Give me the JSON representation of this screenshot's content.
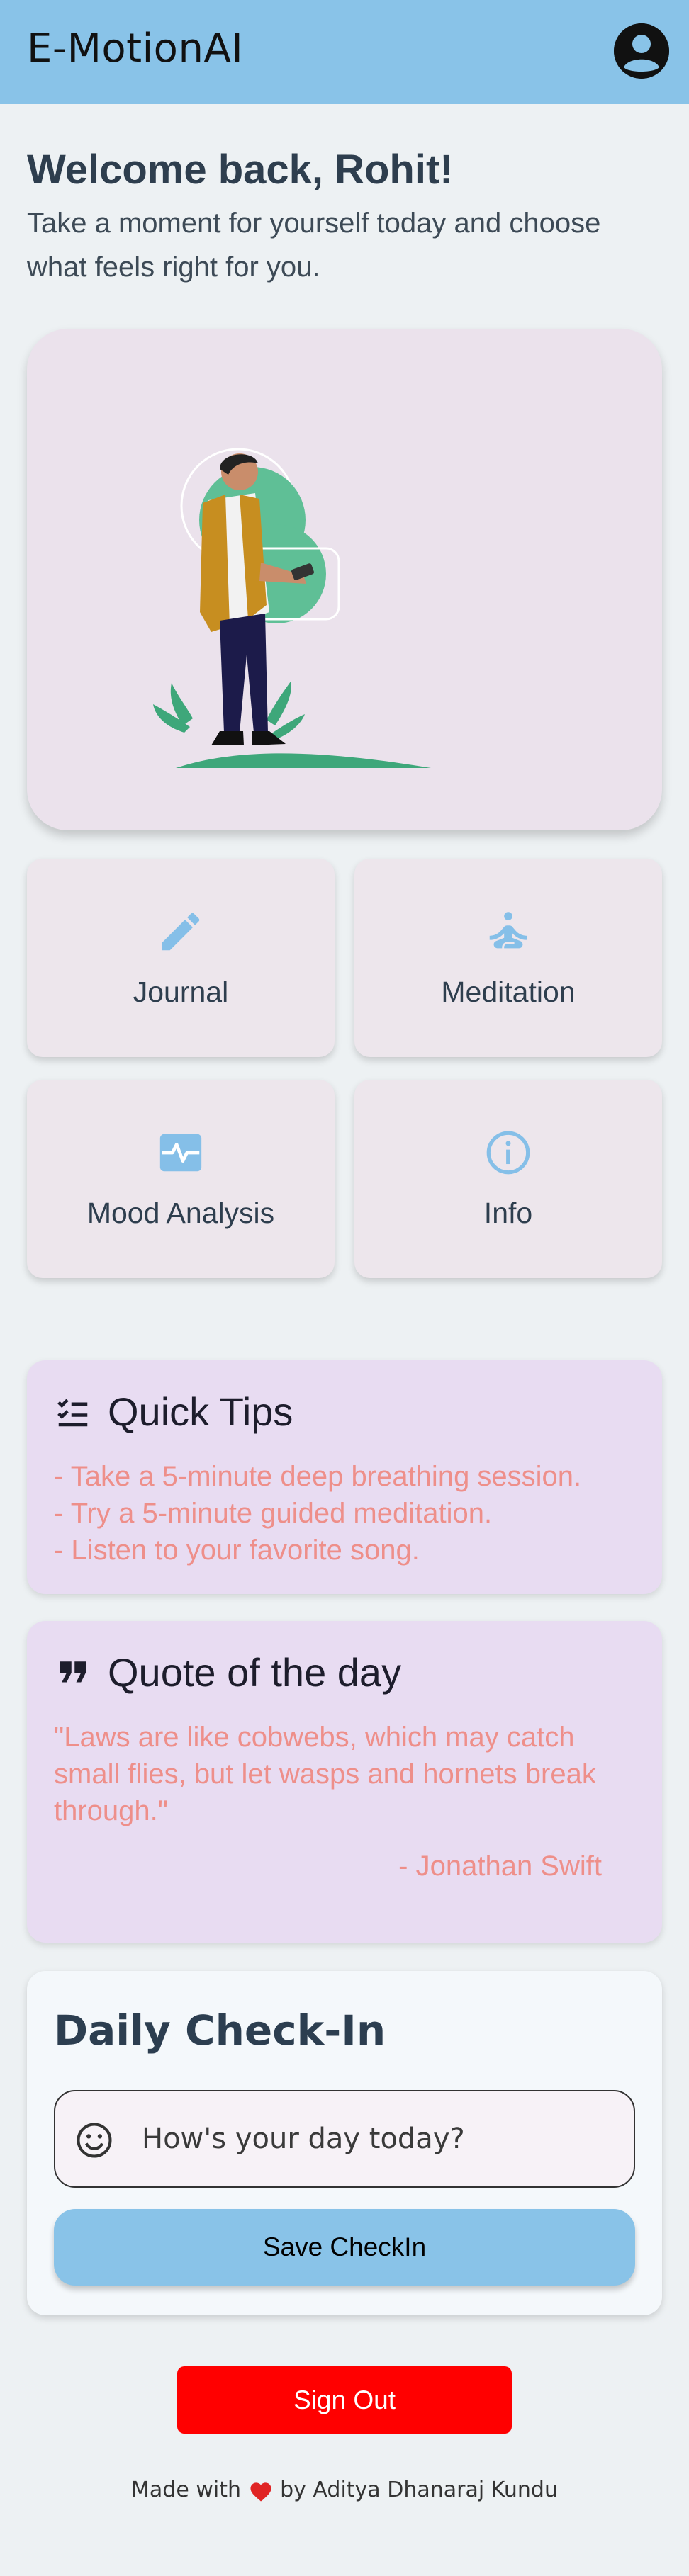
{
  "app": {
    "title": "E-MotionAI"
  },
  "header": {
    "avatar_icon": "account-circle-icon"
  },
  "welcome": {
    "title": "Welcome back, Rohit!",
    "subtitle": "Take a moment for yourself today and choose what feels right for you."
  },
  "hero": {
    "illustration": "person-with-phone-illustration"
  },
  "tiles": [
    {
      "label": "Journal",
      "icon": "pencil-icon"
    },
    {
      "label": "Meditation",
      "icon": "meditation-icon"
    },
    {
      "label": "Mood Analysis",
      "icon": "mood-pulse-icon"
    },
    {
      "label": "Info",
      "icon": "info-icon"
    }
  ],
  "tips": {
    "title": "Quick Tips",
    "icon": "checklist-icon",
    "items": [
      "- Take a 5-minute deep breathing session.",
      "- Try a 5-minute guided meditation.",
      "- Listen to your favorite song."
    ]
  },
  "quote": {
    "title": "Quote of the day",
    "icon": "format-quote-icon",
    "text": "\"Laws are like cobwebs, which may catch small flies, but let wasps and hornets break through.\"",
    "author": "- Jonathan Swift"
  },
  "checkin": {
    "title": "Daily Check-In",
    "placeholder": "How's your day today?",
    "input_icon": "smiley-icon",
    "save_label": "Save CheckIn"
  },
  "signout": {
    "label": "Sign Out"
  },
  "footer": {
    "prefix": "Made with",
    "suffix": "by Aditya Dhanaraj Kundu",
    "heart_icon": "heart-icon"
  },
  "colors": {
    "appbar": "#89c3e8",
    "accent_icon": "#85bfe8",
    "tip_text": "#ee8f8a",
    "card_bg": "#e8dcf2",
    "signout": "#ff0000"
  }
}
